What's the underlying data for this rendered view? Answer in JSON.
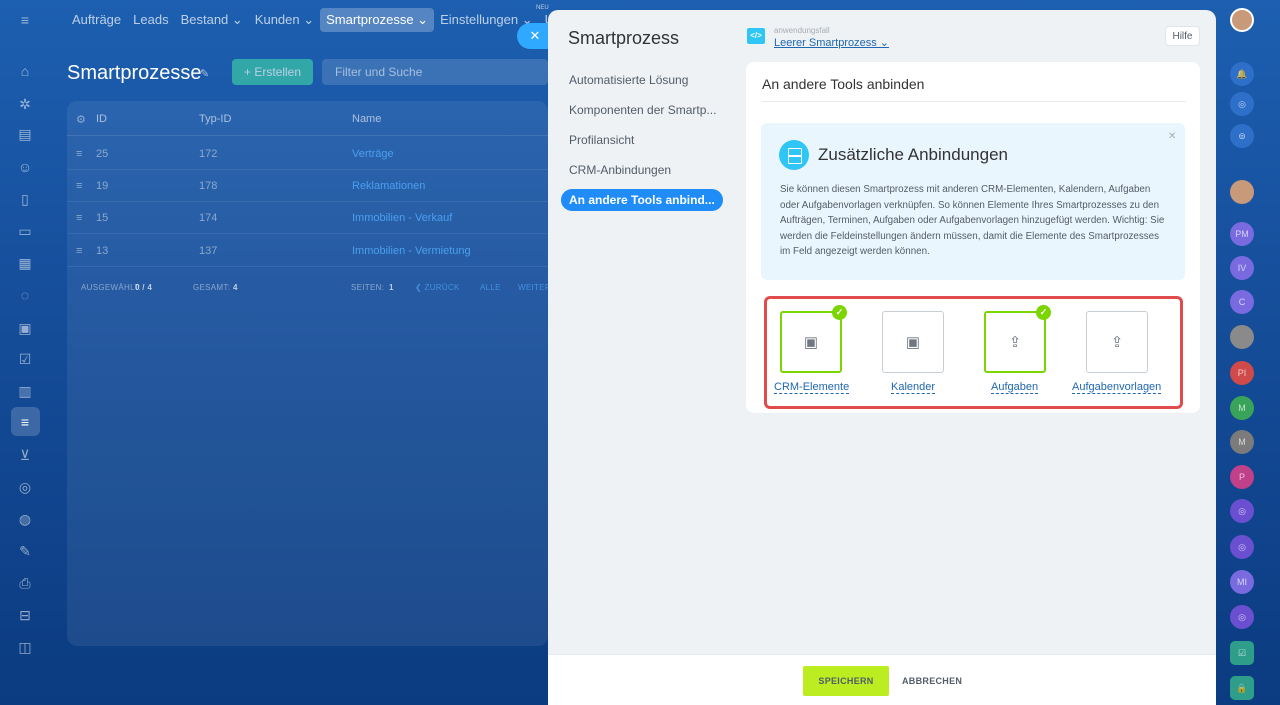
{
  "topnav": [
    "Aufträge",
    "Leads",
    "Bestand ⌄",
    "Kunden ⌄",
    "Smartprozesse ⌄",
    "Einstellungen ⌄",
    "Ur"
  ],
  "topnav_badge": "NEU",
  "page": {
    "title": "Smartprozesse",
    "create_label": "+ Erstellen",
    "filter_placeholder": "Filter und Suche"
  },
  "grid": {
    "columns": [
      "ID",
      "Typ-ID",
      "Name"
    ],
    "rows": [
      {
        "id": "25",
        "type": "172",
        "name": "Verträge"
      },
      {
        "id": "19",
        "type": "178",
        "name": "Reklamationen"
      },
      {
        "id": "15",
        "type": "174",
        "name": "Immobilien - Verkauf"
      },
      {
        "id": "13",
        "type": "137",
        "name": "Immobilien - Vermietung"
      }
    ],
    "selected_label": "AUSGEWÄHLT:",
    "selected_value": "0 / 4",
    "total_label": "GESAMT:",
    "total_value": "4",
    "pages_label": "SEITEN:",
    "pages_value": "1",
    "back": "❮ ZURÜCK",
    "all": "ALLE",
    "next": "WEITER"
  },
  "slider": {
    "title": "Smartprozess",
    "app_icon": "</>",
    "app_label": "anwendungsfall",
    "app_value": "Leerer Smartprozess ⌄",
    "help": "Hilfe",
    "menu": [
      "Automatisierte Lösung",
      "Komponenten der Smartp...",
      "Profilansicht",
      "CRM-Anbindungen",
      "An andere Tools anbind..."
    ],
    "section_title": "An andere Tools anbinden",
    "info_title": "Zusätzliche Anbindungen",
    "info_text": "Sie können diesen Smartprozess mit anderen CRM-Elementen, Kalendern, Aufgaben oder Aufgabenvorlagen verknüpfen. So können Elemente Ihres Smartprozesses zu den Aufträgen, Terminen, Aufgaben oder Aufgabenvorlagen hinzugefügt werden. Wichtig: Sie werden die Feldeinstellungen ändern müssen, damit die Elemente des Smartprozesses im Feld angezeigt werden können.",
    "options": [
      {
        "label": "CRM-Elemente",
        "checked": true,
        "icon": "card-icon"
      },
      {
        "label": "Kalender",
        "checked": false,
        "icon": "card-icon"
      },
      {
        "label": "Aufgaben",
        "checked": true,
        "icon": "share-icon"
      },
      {
        "label": "Aufgabenvorlagen",
        "checked": false,
        "icon": "share-icon"
      }
    ],
    "save": "SPEICHERN",
    "cancel": "ABBRECHEN"
  },
  "rightbar": [
    "PM",
    "IV",
    "C",
    "",
    "PI",
    "M",
    "M",
    "P",
    "",
    "",
    "MI",
    "",
    ""
  ],
  "colors": {
    "accent": "#1f8cf8",
    "save": "#bbed21",
    "check": "#7bd500",
    "highlight": "#e04c4c"
  }
}
